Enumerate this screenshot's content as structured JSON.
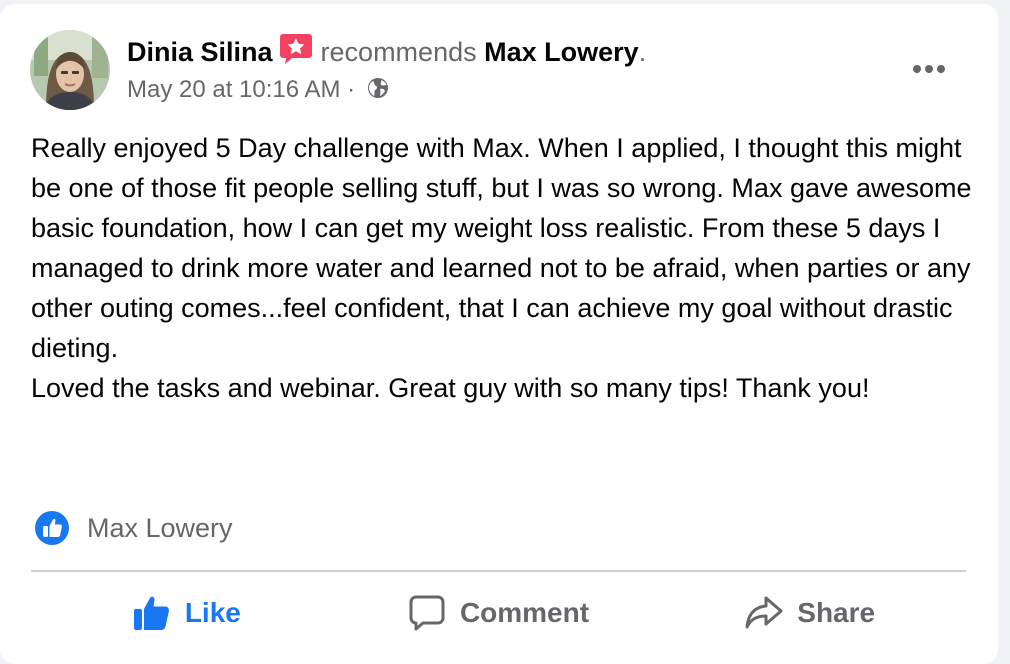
{
  "post": {
    "author": "Dinia Silina",
    "action_text": "recommends",
    "page_name": "Max Lowery",
    "period": ".",
    "timestamp": "May 20 at 10:16 AM",
    "separator": "·",
    "privacy_icon": "globe-icon",
    "recommend_icon": "recommendation-star-icon",
    "more_icon": "more-options-icon",
    "body": [
      "Really enjoyed 5 Day challenge with Max. When I applied, I thought this might be one of those fit people selling stuff, but I was so wrong. Max gave awesome basic foundation, how I can get my weight loss realistic. From these 5 days I managed to drink more water and learned not to be afraid, when parties or any other outing comes...feel confident, that I can achieve my goal without drastic dieting.",
      "Loved the tasks and webinar. Great guy with so many tips! Thank you!"
    ]
  },
  "reactions": {
    "icon": "like-reaction-icon",
    "reactor": "Max Lowery"
  },
  "actions": {
    "like_label": "Like",
    "comment_label": "Comment",
    "share_label": "Share"
  },
  "colors": {
    "accent": "#1877f2",
    "secondary_text": "#65676b",
    "primary_text": "#050505",
    "recommend_badge": "#f3425f",
    "divider": "#ced0d4"
  }
}
